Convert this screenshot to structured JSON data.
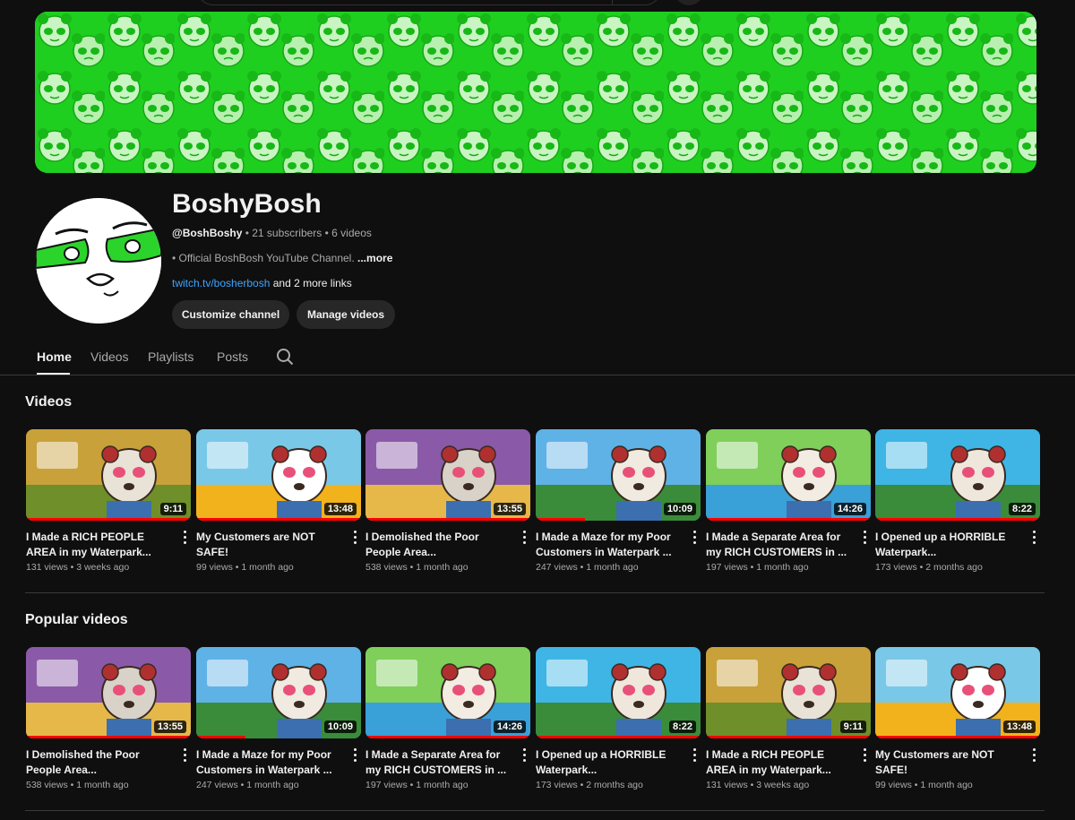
{
  "channel": {
    "name": "BoshyBosh",
    "handle": "@BoshBoshy",
    "subscribers": "21 subscribers",
    "video_count": "6 videos",
    "description": "• Official BoshBosh YouTube Channel.",
    "more_label": "...more",
    "link": "twitch.tv/bosherbosh",
    "more_links": "and 2 more links",
    "separator": " • "
  },
  "buttons": {
    "customize": "Customize channel",
    "manage": "Manage videos"
  },
  "tabs": [
    "Home",
    "Videos",
    "Playlists",
    "Posts"
  ],
  "sections": {
    "videos": "Videos",
    "popular": "Popular videos"
  },
  "colors": {
    "accent_green": "#23d323",
    "link_blue": "#3ea6ff",
    "progress_red": "#ff0000"
  },
  "videos": [
    {
      "title": "I Made a RICH PEOPLE AREA in my Waterpark...",
      "views": "131 views",
      "age": "3 weeks ago",
      "duration": "9:11",
      "progress": 100
    },
    {
      "title": "My Customers are NOT SAFE!",
      "views": "99 views",
      "age": "1 month ago",
      "duration": "13:48",
      "progress": 100
    },
    {
      "title": "I Demolished the Poor People Area...",
      "views": "538 views",
      "age": "1 month ago",
      "duration": "13:55",
      "progress": 100
    },
    {
      "title": "I Made a Maze for my Poor Customers in Waterpark ...",
      "views": "247 views",
      "age": "1 month ago",
      "duration": "10:09",
      "progress": 30
    },
    {
      "title": "I Made a Separate Area for my RICH CUSTOMERS in ...",
      "views": "197 views",
      "age": "1 month ago",
      "duration": "14:26",
      "progress": 100
    },
    {
      "title": "I Opened up a HORRIBLE Waterpark...",
      "views": "173 views",
      "age": "2 months ago",
      "duration": "8:22",
      "progress": 100
    }
  ],
  "popular": [
    {
      "title": "I Demolished the Poor People Area...",
      "views": "538 views",
      "age": "1 month ago",
      "duration": "13:55",
      "progress": 100
    },
    {
      "title": "I Made a Maze for my Poor Customers in Waterpark ...",
      "views": "247 views",
      "age": "1 month ago",
      "duration": "10:09",
      "progress": 30
    },
    {
      "title": "I Made a Separate Area for my RICH CUSTOMERS in ...",
      "views": "197 views",
      "age": "1 month ago",
      "duration": "14:26",
      "progress": 100
    },
    {
      "title": "I Opened up a HORRIBLE Waterpark...",
      "views": "173 views",
      "age": "2 months ago",
      "duration": "8:22",
      "progress": 100
    },
    {
      "title": "I Made a RICH PEOPLE AREA in my Waterpark...",
      "views": "131 views",
      "age": "3 weeks ago",
      "duration": "9:11",
      "progress": 100
    },
    {
      "title": "My Customers are NOT SAFE!",
      "views": "99 views",
      "age": "1 month ago",
      "duration": "13:48",
      "progress": 100
    }
  ]
}
